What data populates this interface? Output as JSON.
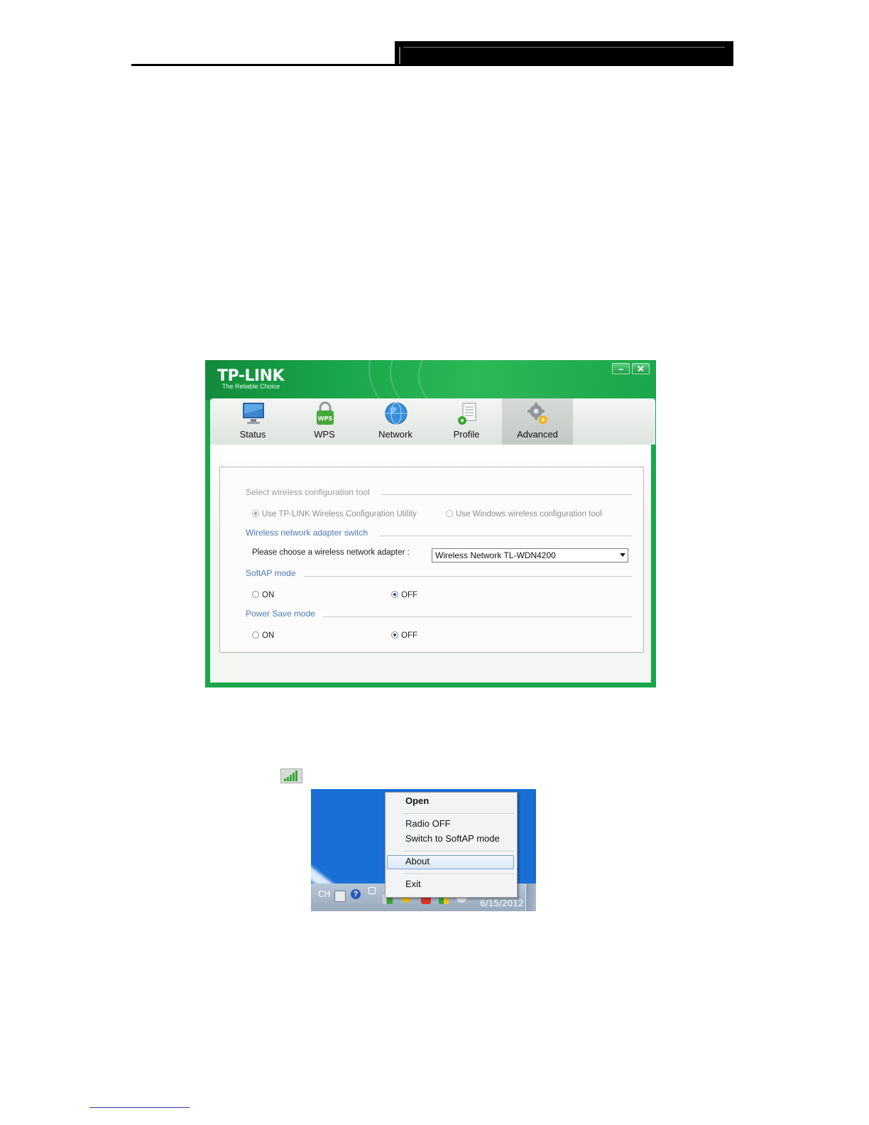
{
  "app": {
    "logo": "TP-LINK",
    "tagline": "The Reliable Choice",
    "minimize_label": "–",
    "close_label": "✕",
    "tabs": [
      {
        "label": "Status",
        "icon": "monitor-icon"
      },
      {
        "label": "WPS",
        "icon": "wps-lock-icon"
      },
      {
        "label": "Network",
        "icon": "globe-icon"
      },
      {
        "label": "Profile",
        "icon": "profile-document-icon"
      },
      {
        "label": "Advanced",
        "icon": "gears-icon"
      }
    ],
    "active_tab": "Advanced",
    "sections": {
      "config_tool": {
        "title": "Select wireless configuration tool",
        "option_tplink": "Use TP-LINK Wireless Configuration Utility",
        "option_windows": "Use Windows wireless configuration tool",
        "selected": "option_tplink"
      },
      "adapter_switch": {
        "title": "Wireless network adapter switch",
        "prompt": "Please choose a wireless network adapter :",
        "selected_adapter": "Wireless Network  TL-WDN4200"
      },
      "softap": {
        "title": "SoftAP mode",
        "on_label": "ON",
        "off_label": "OFF",
        "selected": "OFF"
      },
      "power_save": {
        "title": "Power Save mode",
        "on_label": "ON",
        "off_label": "OFF",
        "selected": "OFF"
      }
    },
    "colors": {
      "brand_green": "#1aa64a",
      "section_blue": "#4f7ab8"
    }
  },
  "tray": {
    "signal_icon": "signal-bars-icon",
    "language": "CH",
    "date": "6/15/2012",
    "menu": {
      "open": "Open",
      "radio_off": "Radio OFF",
      "switch_softap": "Switch to SoftAP mode",
      "about": "About",
      "exit": "Exit",
      "highlighted": "About"
    }
  }
}
